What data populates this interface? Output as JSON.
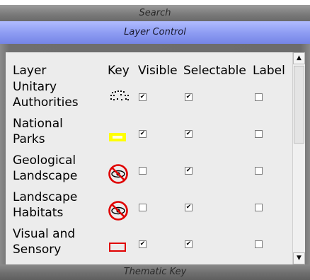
{
  "bars": {
    "search": "Search",
    "layer_control": "Layer Control",
    "thematic_key": "Thematic Key"
  },
  "columns": {
    "layer": "Layer",
    "key": "Key",
    "visible": "Visible",
    "selectable": "Selectable",
    "label": "Label"
  },
  "rows": [
    {
      "name_line1": "Unitary",
      "name_line2": "Authorities",
      "key_icon": "dotted-boundary-icon",
      "visible": true,
      "selectable": true,
      "label": false
    },
    {
      "name_line1": "National",
      "name_line2": "Parks",
      "key_icon": "yellow-rectangle-icon",
      "visible": true,
      "selectable": true,
      "label": false
    },
    {
      "name_line1": "Geological",
      "name_line2": "Landscape",
      "key_icon": "hidden-eye-icon",
      "visible": false,
      "selectable": true,
      "label": false
    },
    {
      "name_line1": "Landscape",
      "name_line2": "Habitats",
      "key_icon": "hidden-eye-icon",
      "visible": false,
      "selectable": true,
      "label": false
    },
    {
      "name_line1": "Visual and",
      "name_line2": "Sensory",
      "key_icon": "red-rectangle-icon",
      "visible": true,
      "selectable": true,
      "label": false
    }
  ],
  "colors": {
    "accent_bar": "#8f9df3",
    "national_parks_fill": "#ffff00",
    "visual_sensory_stroke": "#e00000",
    "hidden_icon_red": "#e00000"
  }
}
